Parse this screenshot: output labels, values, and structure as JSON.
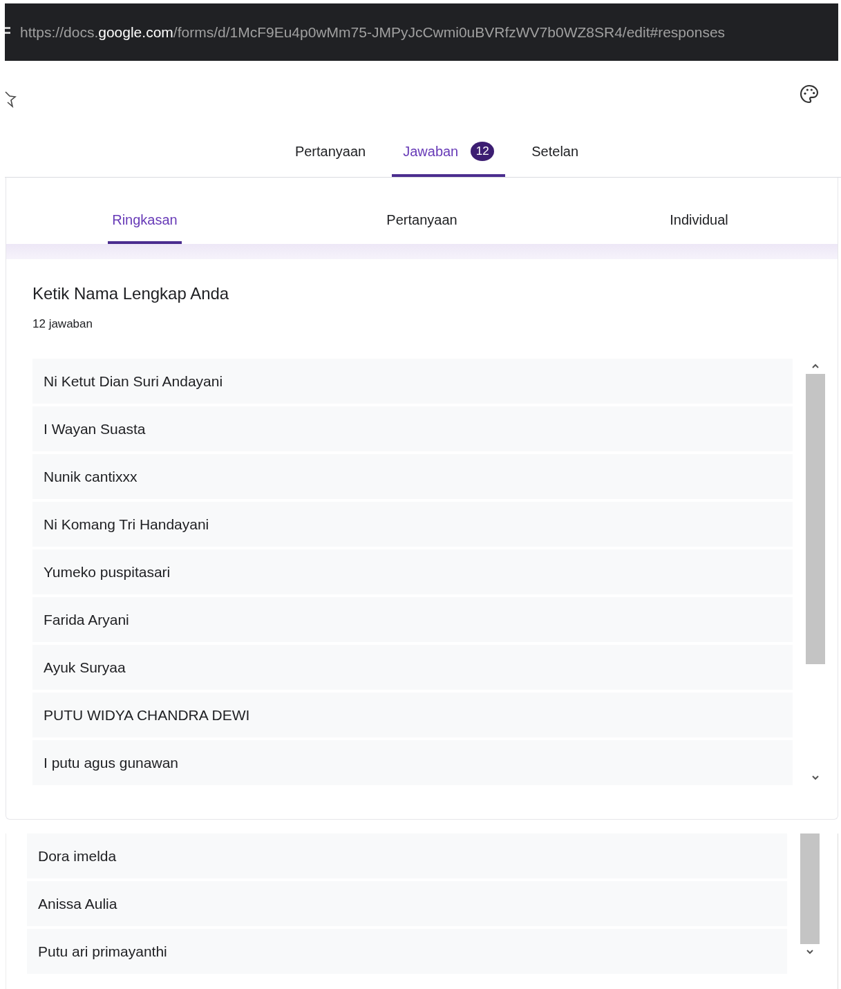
{
  "address_bar": {
    "url_parts": [
      {
        "text": "https://docs.",
        "highlighted": false
      },
      {
        "text": "google.com",
        "highlighted": true
      },
      {
        "text": "/forms/d/1McF9Eu4p0wMm75-JMPyJcCwmi0uBVRfzWV7b0WZ8SR4/edit#responses",
        "highlighted": false
      }
    ]
  },
  "tabs": [
    {
      "label": "Pertanyaan",
      "selected": false
    },
    {
      "label": "Jawaban",
      "selected": true,
      "badge": "12"
    },
    {
      "label": "Setelan",
      "selected": false
    }
  ],
  "subtabs": [
    {
      "label": "Ringkasan",
      "selected": true
    },
    {
      "label": "Pertanyaan",
      "selected": false
    },
    {
      "label": "Individual",
      "selected": false
    }
  ],
  "question": {
    "title": "Ketik Nama Lengkap Anda",
    "count": "12 jawaban",
    "responses": [
      "Ni Ketut Dian Suri Andayani",
      "I Wayan Suasta",
      "Nunik cantixxx",
      "Ni Komang Tri Handayani",
      "Yumeko puspitasari",
      "Farida Aryani",
      "Ayuk Suryaa",
      "PUTU WIDYA CHANDRA DEWI",
      "I putu agus gunawan"
    ]
  },
  "continued_responses": [
    "Dora imelda",
    "Anissa Aulia",
    "Putu ari primayanthi"
  ]
}
